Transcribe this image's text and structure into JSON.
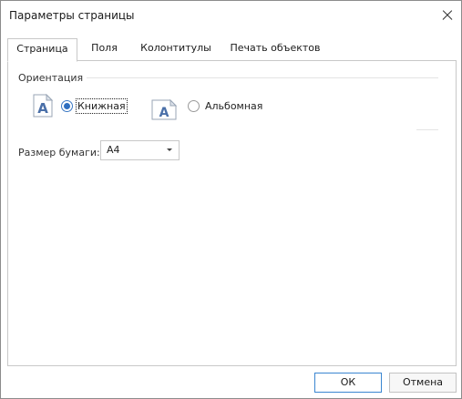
{
  "window": {
    "title": "Параметры страницы"
  },
  "tabs": [
    {
      "label": "Страница",
      "active": true
    },
    {
      "label": "Поля",
      "active": false
    },
    {
      "label": "Колонтитулы",
      "active": false
    },
    {
      "label": "Печать объектов",
      "active": false
    }
  ],
  "orientation": {
    "group_label": "Ориентация",
    "icon_letter": "A",
    "portrait": {
      "label": "Книжная",
      "selected": true
    },
    "landscape": {
      "label": "Альбомная",
      "selected": false
    }
  },
  "paper": {
    "label": "Размер бумаги:",
    "value": "A4"
  },
  "buttons": {
    "ok": "ОК",
    "cancel": "Отмена"
  },
  "colors": {
    "accent": "#2f6fc0",
    "icon_blue": "#4a6fa8"
  }
}
